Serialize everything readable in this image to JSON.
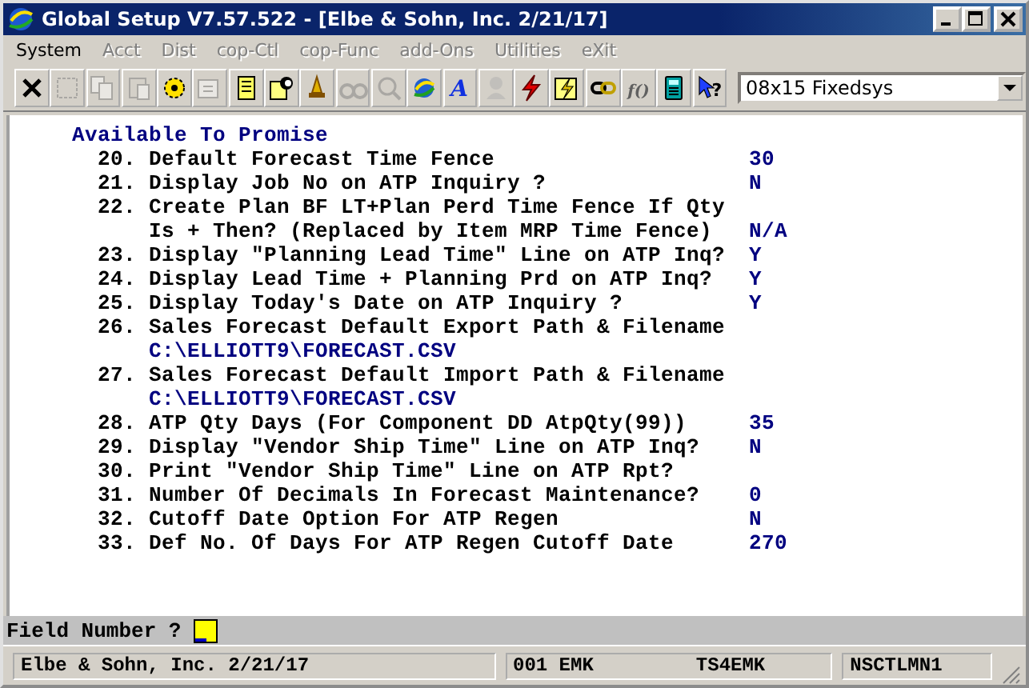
{
  "window": {
    "title": "Global Setup V7.57.522 - [Elbe & Sohn, Inc. 2/21/17]"
  },
  "menu": [
    {
      "label": "System",
      "disabled": false
    },
    {
      "label": "Acct",
      "disabled": true
    },
    {
      "label": "Dist",
      "disabled": true
    },
    {
      "label": "cop-Ctl",
      "disabled": true
    },
    {
      "label": "cop-Func",
      "disabled": true
    },
    {
      "label": "add-Ons",
      "disabled": true
    },
    {
      "label": "Utilities",
      "disabled": true
    },
    {
      "label": "eXit",
      "disabled": true
    }
  ],
  "toolbar": [
    {
      "disabled": false
    },
    {
      "disabled": true
    },
    {
      "disabled": true
    },
    {
      "disabled": true
    },
    {
      "disabled": false
    },
    {
      "disabled": true
    },
    {
      "disabled": false
    },
    {
      "disabled": false
    },
    {
      "disabled": false
    },
    {
      "disabled": true
    },
    {
      "disabled": true
    },
    {
      "disabled": false
    },
    {
      "disabled": false,
      "glyph": "A"
    },
    {
      "disabled": true
    },
    {
      "disabled": false
    },
    {
      "disabled": false
    },
    {
      "disabled": false
    },
    {
      "disabled": true,
      "glyph": "f()"
    },
    {
      "disabled": false
    },
    {
      "disabled": false,
      "glyph": "?"
    }
  ],
  "font_select": {
    "value": "08x15 Fixedsys"
  },
  "section_title": "Available To Promise",
  "fields": [
    {
      "number": "20.",
      "lines": [
        "Default Forecast Time Fence"
      ],
      "value": "30"
    },
    {
      "number": "21.",
      "lines": [
        "Display Job No on ATP Inquiry ?"
      ],
      "value": "N"
    },
    {
      "number": "22.",
      "lines": [
        "Create Plan BF LT+Plan Perd Time Fence If Qty",
        "Is + Then? (Replaced by Item MRP Time Fence)"
      ],
      "value": "N/A"
    },
    {
      "number": "23.",
      "lines": [
        "Display \"Planning Lead Time\" Line on ATP Inq?"
      ],
      "value": "Y"
    },
    {
      "number": "24.",
      "lines": [
        "Display Lead Time + Planning Prd on ATP Inq?"
      ],
      "value": "Y"
    },
    {
      "number": "25.",
      "lines": [
        "Display Today's Date on ATP Inquiry ?"
      ],
      "value": "Y"
    },
    {
      "number": "26.",
      "lines": [
        "Sales Forecast Default Export Path & Filename"
      ],
      "path": "C:\\ELLIOTT9\\FORECAST.CSV"
    },
    {
      "number": "27.",
      "lines": [
        "Sales Forecast Default Import Path & Filename"
      ],
      "path": "C:\\ELLIOTT9\\FORECAST.CSV"
    },
    {
      "number": "28.",
      "lines": [
        "ATP Qty Days (For Component DD AtpQty(99))"
      ],
      "value": "35"
    },
    {
      "number": "29.",
      "lines": [
        "Display \"Vendor Ship Time\" Line on ATP Inq?"
      ],
      "value": "N"
    },
    {
      "number": "30.",
      "lines": [
        "Print \"Vendor Ship Time\" Line on ATP Rpt?"
      ]
    },
    {
      "number": "31.",
      "lines": [
        "Number Of Decimals In Forecast Maintenance?"
      ],
      "value": "0"
    },
    {
      "number": "32.",
      "lines": [
        "Cutoff Date Option For ATP Regen"
      ],
      "value": "N"
    },
    {
      "number": "33.",
      "lines": [
        "Def No. Of Days For ATP Regen Cutoff Date"
      ],
      "value": "270"
    }
  ],
  "prompt": {
    "label": "Field Number ?"
  },
  "status_bar": {
    "company": "Elbe & Sohn, Inc. 2/21/17",
    "code": "001 EMK",
    "user": "TS4EMK",
    "program": "NSCTLMN1"
  }
}
